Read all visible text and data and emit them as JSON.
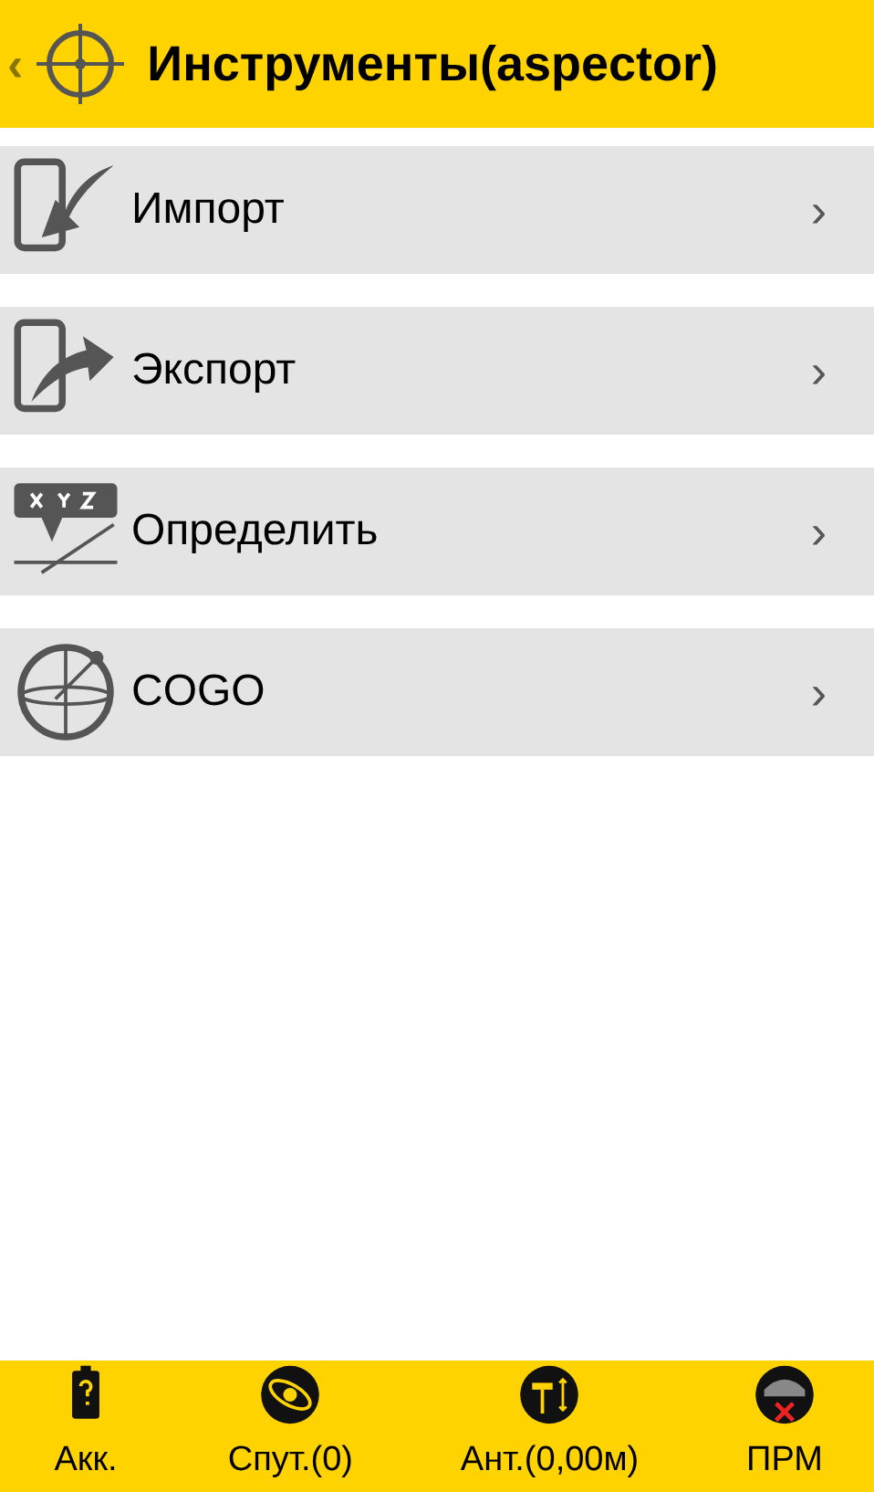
{
  "header": {
    "back": "‹",
    "title": "Инструменты(aspector)"
  },
  "items": [
    {
      "label": "Импорт",
      "chevron": "›"
    },
    {
      "label": "Экспорт",
      "chevron": "›"
    },
    {
      "label": "Определить",
      "chevron": "›"
    },
    {
      "label": "COGO",
      "chevron": "›"
    }
  ],
  "status_bar": [
    {
      "label": "Акк."
    },
    {
      "label": "Спут.(0)"
    },
    {
      "label": "Ант.(0,00м)"
    },
    {
      "label": "ПРМ"
    }
  ]
}
